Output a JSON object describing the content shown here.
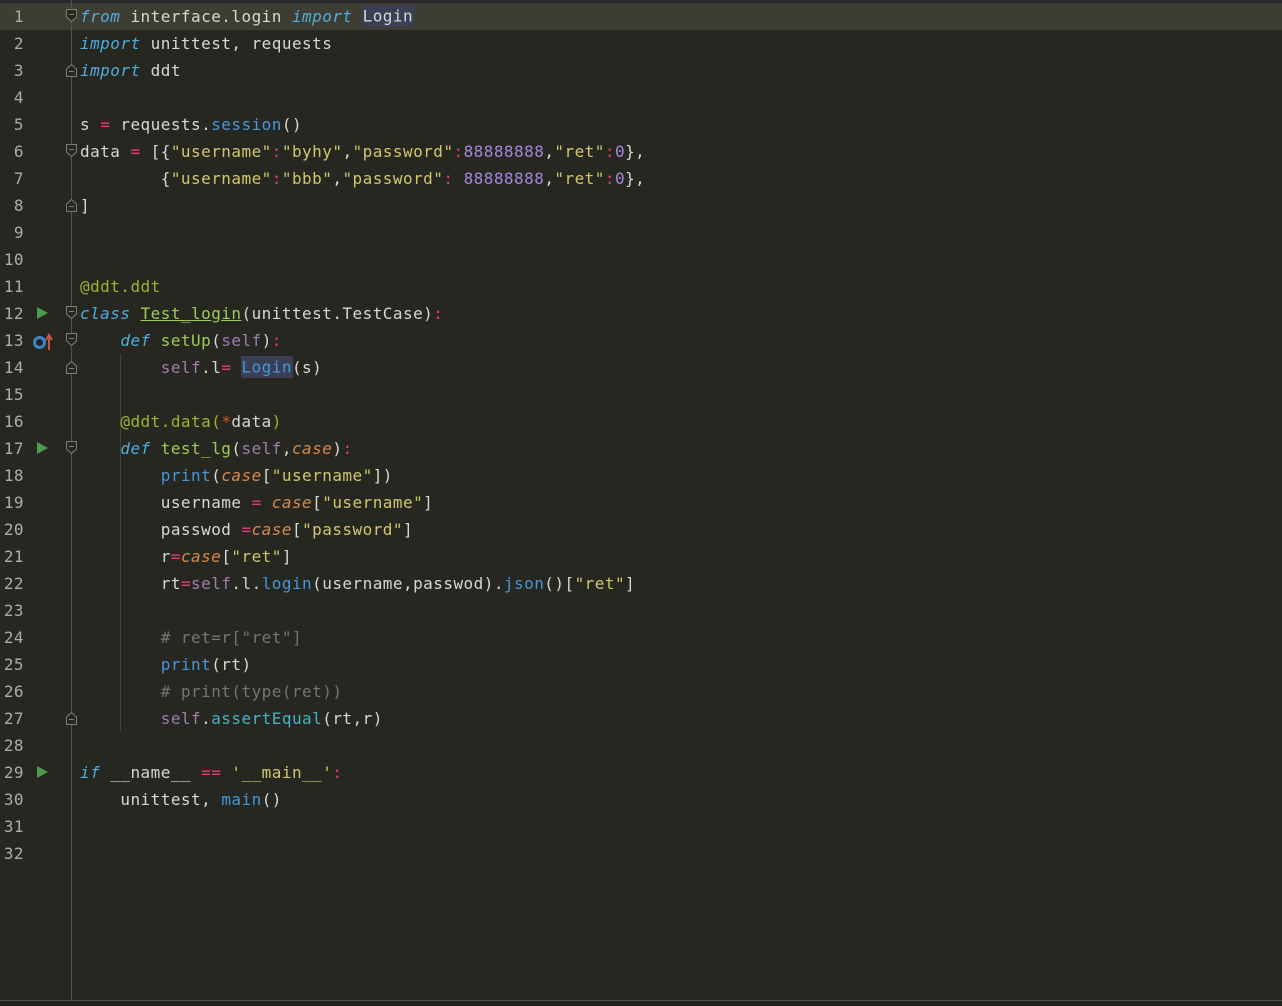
{
  "app": {
    "name": "python-unittest-editor",
    "file_language": "python"
  },
  "palette": {
    "background": "#272722",
    "top_edge": "#29292a",
    "caret_line_bg": "#3d3d33",
    "gutter_text": "#adada3",
    "separator": "#53534c",
    "indent_guide": "#42423b",
    "bottom_area": "#24241f",
    "plain": "#d8d8d0",
    "keyword": "#4facdd",
    "func_call": "#4795d7",
    "method_ref": "#42b4c4",
    "def_name": "#9ecb55",
    "decorator": "#a0b32c",
    "string": "#d0c868",
    "number": "#a487dd",
    "operator": "#e73c74",
    "self_kw": "#9c7fae",
    "param": "#d6894a",
    "star": "#d5552b",
    "comment": "#75756d",
    "highlight_bg": "#3b3f55",
    "run_arrow": "#4c9b51",
    "override_circle": "#3a87c2",
    "override_arrow": "#c4544c",
    "fold_stroke": "#7d7d75"
  },
  "editor": {
    "caret_line_number": 1,
    "total_lines": 32,
    "lines": [
      {
        "num": 1,
        "fold": "start",
        "segments": [
          {
            "text": "from",
            "color": "keyword",
            "italic": true
          },
          {
            "text": " interface.login ",
            "color": "plain"
          },
          {
            "text": "import",
            "color": "keyword",
            "italic": true
          },
          {
            "text": " ",
            "color": "plain"
          },
          {
            "text": "Login",
            "color": "plain",
            "highlight": true
          }
        ]
      },
      {
        "num": 2,
        "segments": [
          {
            "text": "import",
            "color": "keyword",
            "italic": true
          },
          {
            "text": " unittest, requests",
            "color": "plain"
          }
        ]
      },
      {
        "num": 3,
        "fold": "end",
        "segments": [
          {
            "text": "import",
            "color": "keyword",
            "italic": true
          },
          {
            "text": " ddt",
            "color": "plain"
          }
        ]
      },
      {
        "num": 4,
        "segments": []
      },
      {
        "num": 5,
        "segments": [
          {
            "text": "s ",
            "color": "plain"
          },
          {
            "text": "=",
            "color": "operator"
          },
          {
            "text": " requests.",
            "color": "plain"
          },
          {
            "text": "session",
            "color": "func_call"
          },
          {
            "text": "()",
            "color": "plain"
          }
        ]
      },
      {
        "num": 6,
        "fold": "start",
        "segments": [
          {
            "text": "data ",
            "color": "plain"
          },
          {
            "text": "=",
            "color": "operator"
          },
          {
            "text": " [{",
            "color": "plain"
          },
          {
            "text": "\"username\"",
            "color": "string"
          },
          {
            "text": ":",
            "color": "operator"
          },
          {
            "text": "\"byhy\"",
            "color": "string"
          },
          {
            "text": ",",
            "color": "plain"
          },
          {
            "text": "\"password\"",
            "color": "string"
          },
          {
            "text": ":",
            "color": "operator"
          },
          {
            "text": "88888888",
            "color": "number"
          },
          {
            "text": ",",
            "color": "plain"
          },
          {
            "text": "\"ret\"",
            "color": "string"
          },
          {
            "text": ":",
            "color": "operator"
          },
          {
            "text": "0",
            "color": "number"
          },
          {
            "text": "},",
            "color": "plain"
          }
        ]
      },
      {
        "num": 7,
        "segments": [
          {
            "text": "        {",
            "color": "plain"
          },
          {
            "text": "\"username\"",
            "color": "string"
          },
          {
            "text": ":",
            "color": "operator"
          },
          {
            "text": "\"bbb\"",
            "color": "string"
          },
          {
            "text": ",",
            "color": "plain"
          },
          {
            "text": "\"password\"",
            "color": "string"
          },
          {
            "text": ":",
            "color": "operator"
          },
          {
            "text": " ",
            "color": "plain"
          },
          {
            "text": "88888888",
            "color": "number"
          },
          {
            "text": ",",
            "color": "plain"
          },
          {
            "text": "\"ret\"",
            "color": "string"
          },
          {
            "text": ":",
            "color": "operator"
          },
          {
            "text": "0",
            "color": "number"
          },
          {
            "text": "},",
            "color": "plain"
          }
        ]
      },
      {
        "num": 8,
        "fold": "end",
        "segments": [
          {
            "text": "]",
            "color": "plain"
          }
        ]
      },
      {
        "num": 9,
        "segments": []
      },
      {
        "num": 10,
        "segments": []
      },
      {
        "num": 11,
        "segments": [
          {
            "text": "@ddt.ddt",
            "color": "decorator"
          }
        ]
      },
      {
        "num": 12,
        "icon": "run",
        "fold": "start",
        "segments": [
          {
            "text": "class",
            "color": "keyword",
            "italic": true
          },
          {
            "text": " ",
            "color": "plain"
          },
          {
            "text": "Test_login",
            "color": "def_name",
            "underline": true
          },
          {
            "text": "(unittest.TestCase)",
            "color": "plain"
          },
          {
            "text": ":",
            "color": "operator"
          }
        ]
      },
      {
        "num": 13,
        "icon": "override",
        "fold": "start",
        "segments": [
          {
            "text": "    ",
            "color": "plain"
          },
          {
            "text": "def",
            "color": "keyword",
            "italic": true
          },
          {
            "text": " ",
            "color": "plain"
          },
          {
            "text": "setUp",
            "color": "def_name"
          },
          {
            "text": "(",
            "color": "plain"
          },
          {
            "text": "self",
            "color": "self_kw"
          },
          {
            "text": ")",
            "color": "plain"
          },
          {
            "text": ":",
            "color": "operator"
          }
        ]
      },
      {
        "num": 14,
        "fold": "end",
        "segments": [
          {
            "text": "        ",
            "color": "plain"
          },
          {
            "text": "self",
            "color": "self_kw"
          },
          {
            "text": ".l",
            "color": "plain"
          },
          {
            "text": "=",
            "color": "operator"
          },
          {
            "text": " ",
            "color": "plain"
          },
          {
            "text": "Login",
            "color": "func_call",
            "highlight": true
          },
          {
            "text": "(s)",
            "color": "plain"
          }
        ]
      },
      {
        "num": 15,
        "segments": []
      },
      {
        "num": 16,
        "segments": [
          {
            "text": "    ",
            "color": "plain"
          },
          {
            "text": "@ddt.data(",
            "color": "decorator"
          },
          {
            "text": "*",
            "color": "star"
          },
          {
            "text": "data",
            "color": "plain"
          },
          {
            "text": ")",
            "color": "decorator"
          }
        ]
      },
      {
        "num": 17,
        "icon": "run",
        "fold": "start",
        "segments": [
          {
            "text": "    ",
            "color": "plain"
          },
          {
            "text": "def",
            "color": "keyword",
            "italic": true
          },
          {
            "text": " ",
            "color": "plain"
          },
          {
            "text": "test_lg",
            "color": "def_name"
          },
          {
            "text": "(",
            "color": "plain"
          },
          {
            "text": "self",
            "color": "self_kw"
          },
          {
            "text": ",",
            "color": "plain"
          },
          {
            "text": "case",
            "color": "param",
            "italic": true
          },
          {
            "text": ")",
            "color": "plain"
          },
          {
            "text": ":",
            "color": "operator"
          }
        ]
      },
      {
        "num": 18,
        "segments": [
          {
            "text": "        ",
            "color": "plain"
          },
          {
            "text": "print",
            "color": "func_call"
          },
          {
            "text": "(",
            "color": "plain"
          },
          {
            "text": "case",
            "color": "param",
            "italic": true
          },
          {
            "text": "[",
            "color": "plain"
          },
          {
            "text": "\"username\"",
            "color": "string"
          },
          {
            "text": "])",
            "color": "plain"
          }
        ]
      },
      {
        "num": 19,
        "segments": [
          {
            "text": "        username ",
            "color": "plain"
          },
          {
            "text": "=",
            "color": "operator"
          },
          {
            "text": " ",
            "color": "plain"
          },
          {
            "text": "case",
            "color": "param",
            "italic": true
          },
          {
            "text": "[",
            "color": "plain"
          },
          {
            "text": "\"username\"",
            "color": "string"
          },
          {
            "text": "]",
            "color": "plain"
          }
        ]
      },
      {
        "num": 20,
        "segments": [
          {
            "text": "        passwod ",
            "color": "plain"
          },
          {
            "text": "=",
            "color": "operator"
          },
          {
            "text": "case",
            "color": "param",
            "italic": true
          },
          {
            "text": "[",
            "color": "plain"
          },
          {
            "text": "\"password\"",
            "color": "string"
          },
          {
            "text": "]",
            "color": "plain"
          }
        ]
      },
      {
        "num": 21,
        "segments": [
          {
            "text": "        r",
            "color": "plain"
          },
          {
            "text": "=",
            "color": "operator"
          },
          {
            "text": "case",
            "color": "param",
            "italic": true
          },
          {
            "text": "[",
            "color": "plain"
          },
          {
            "text": "\"ret\"",
            "color": "string"
          },
          {
            "text": "]",
            "color": "plain"
          }
        ]
      },
      {
        "num": 22,
        "segments": [
          {
            "text": "        rt",
            "color": "plain"
          },
          {
            "text": "=",
            "color": "operator"
          },
          {
            "text": "self",
            "color": "self_kw"
          },
          {
            "text": ".l.",
            "color": "plain"
          },
          {
            "text": "login",
            "color": "func_call"
          },
          {
            "text": "(username,passwod).",
            "color": "plain"
          },
          {
            "text": "json",
            "color": "func_call"
          },
          {
            "text": "()[",
            "color": "plain"
          },
          {
            "text": "\"ret\"",
            "color": "string"
          },
          {
            "text": "]",
            "color": "plain"
          }
        ]
      },
      {
        "num": 23,
        "segments": []
      },
      {
        "num": 24,
        "segments": [
          {
            "text": "        ",
            "color": "plain"
          },
          {
            "text": "# ret=r[\"ret\"]",
            "color": "comment"
          }
        ]
      },
      {
        "num": 25,
        "segments": [
          {
            "text": "        ",
            "color": "plain"
          },
          {
            "text": "print",
            "color": "func_call"
          },
          {
            "text": "(rt)",
            "color": "plain"
          }
        ]
      },
      {
        "num": 26,
        "segments": [
          {
            "text": "        ",
            "color": "plain"
          },
          {
            "text": "# print(type(ret))",
            "color": "comment"
          }
        ]
      },
      {
        "num": 27,
        "fold": "end",
        "segments": [
          {
            "text": "        ",
            "color": "plain"
          },
          {
            "text": "self",
            "color": "self_kw"
          },
          {
            "text": ".",
            "color": "plain"
          },
          {
            "text": "assertEqual",
            "color": "method_ref"
          },
          {
            "text": "(rt,r)",
            "color": "plain"
          }
        ]
      },
      {
        "num": 28,
        "segments": []
      },
      {
        "num": 29,
        "icon": "run",
        "segments": [
          {
            "text": "if",
            "color": "keyword",
            "italic": true
          },
          {
            "text": " __name__ ",
            "color": "plain"
          },
          {
            "text": "==",
            "color": "operator"
          },
          {
            "text": " ",
            "color": "plain"
          },
          {
            "text": "'__main__'",
            "color": "string"
          },
          {
            "text": ":",
            "color": "operator"
          }
        ]
      },
      {
        "num": 30,
        "segments": [
          {
            "text": "    unittest, ",
            "color": "plain"
          },
          {
            "text": "main",
            "color": "func_call"
          },
          {
            "text": "()",
            "color": "plain"
          }
        ]
      },
      {
        "num": 31,
        "segments": []
      },
      {
        "num": 32,
        "segments": []
      }
    ]
  }
}
